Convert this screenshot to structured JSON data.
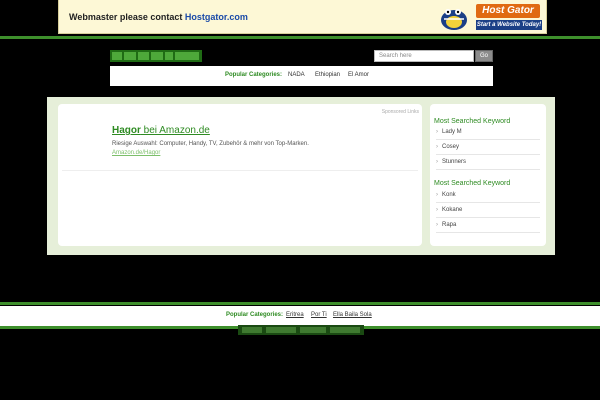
{
  "banner": {
    "message": "Webmaster please contact ",
    "link": "Hostgator.com",
    "logo_title": "Host Gator",
    "logo_tagline": "Start a Website Today!"
  },
  "header": {
    "logo_text": "hagor.com",
    "search_placeholder": "Search here",
    "search_button": "Go"
  },
  "categories": {
    "label": "Popular Categories:",
    "items": [
      "NADA",
      "Ethiopian",
      "El Amor"
    ]
  },
  "ad": {
    "sponsored_label": "Sponsored Links",
    "title_keyword": "Hagor",
    "title_rest": " bei Amazon.de",
    "description": "Riesige Auswahl: Computer, Handy, TV, Zubehör & mehr von Top-Marken.",
    "url": "Amazon.de/Hagor"
  },
  "sidebar": {
    "sections": [
      {
        "heading": "Most Searched Keyword",
        "items": [
          "Lady M",
          "Cosey",
          "Stunners"
        ]
      },
      {
        "heading": "Most Searched Keyword",
        "items": [
          "Konk",
          "Kokane",
          "Rapa"
        ]
      }
    ]
  },
  "footer": {
    "label": "Popular Categories:",
    "items": [
      "Eritrea",
      "Por Ti",
      "Ella Baila Sola"
    ]
  },
  "colors": {
    "accent_green": "#2e8b22",
    "panel_bg": "#e6efd9",
    "banner_bg": "#fdf8d6",
    "hostgator_orange": "#e06a12",
    "hostgator_blue": "#1b3f86"
  }
}
